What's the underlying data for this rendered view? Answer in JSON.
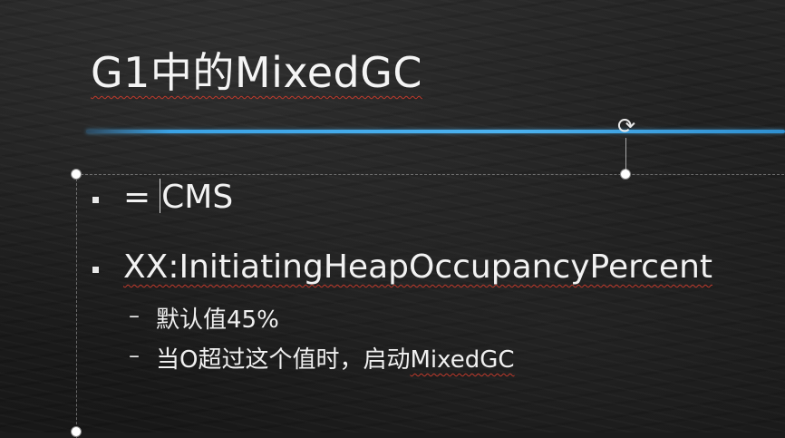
{
  "slide": {
    "title": "G1中的MixedGC",
    "bullets": [
      {
        "prefix": "=",
        "text": "CMS"
      },
      {
        "text": "XX:InitiatingHeapOccupancyPercent"
      }
    ],
    "sub_dash": "–",
    "sub_items": [
      {
        "text": "默认值45%"
      },
      {
        "prefix": "当O超过这个值时，启动",
        "text": "MixedGC"
      }
    ]
  },
  "colors": {
    "background": "#1b1b1b",
    "text": "#f2f2f2",
    "accent_line": "#4db3f0",
    "spellcheck": "#c0392b"
  },
  "icons": {
    "rotate": "rotate-handle-icon",
    "bullet": "square-bullet-icon"
  }
}
